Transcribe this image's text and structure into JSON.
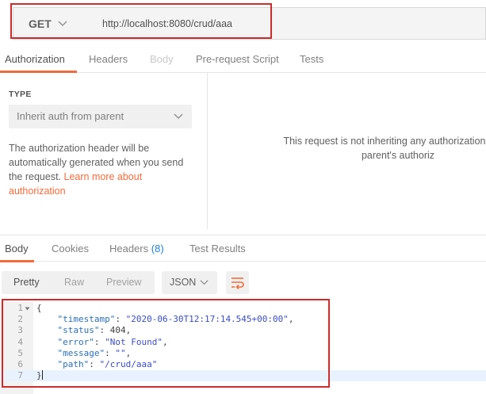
{
  "request": {
    "method": "GET",
    "url": "http://localhost:8080/crud/aaa"
  },
  "request_tabs": [
    {
      "label": "Authorization",
      "state": "active"
    },
    {
      "label": "Headers",
      "state": "normal"
    },
    {
      "label": "Body",
      "state": "disabled"
    },
    {
      "label": "Pre-request Script",
      "state": "normal"
    },
    {
      "label": "Tests",
      "state": "normal"
    }
  ],
  "auth": {
    "type_label": "TYPE",
    "type_value": "Inherit auth from parent",
    "description": "The authorization header will be automatically generated when you send the request.",
    "link_text": "Learn more about authorization",
    "inherit_message_line1": "This request is not inheriting any authorization helpe",
    "inherit_message_line2": "parent's authoriz"
  },
  "response_tabs": {
    "body": "Body",
    "cookies": "Cookies",
    "headers": "Headers",
    "headers_count": "(8)",
    "test_results": "Test Results"
  },
  "response_toolbar": {
    "pretty": "Pretty",
    "raw": "Raw",
    "preview": "Preview",
    "format": "JSON"
  },
  "response_body": {
    "line_numbers": [
      "1",
      "2",
      "3",
      "4",
      "5",
      "6",
      "7"
    ],
    "open_brace": "{",
    "close_brace": "}",
    "fields": [
      {
        "key": "\"timestamp\"",
        "value": "\"2020-06-30T12:17:14.545+00:00\"",
        "comma": ","
      },
      {
        "key": "\"status\"",
        "value": "404",
        "comma": ","
      },
      {
        "key": "\"error\"",
        "value": "\"Not Found\"",
        "comma": ","
      },
      {
        "key": "\"message\"",
        "value": "\"\"",
        "comma": ","
      },
      {
        "key": "\"path\"",
        "value": "\"/crud/aaa\"",
        "comma": ""
      }
    ]
  },
  "colors": {
    "accent": "#f26b3a",
    "highlight_box": "#cc2b2b",
    "link_blue": "#1a7fd4"
  },
  "icons": {
    "method_dropdown": "chevron-down-icon",
    "auth_dropdown": "chevron-down-icon",
    "format_dropdown": "chevron-down-icon",
    "wrap": "wrap-lines-icon",
    "fold": "fold-arrow-icon"
  }
}
